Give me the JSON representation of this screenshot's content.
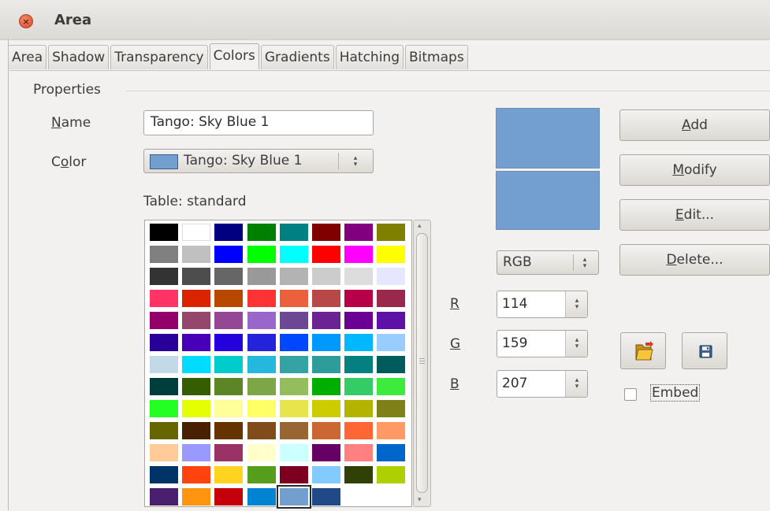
{
  "window": {
    "title": "Area",
    "close_glyph": "×"
  },
  "tabs": [
    {
      "label": "Area",
      "active": false
    },
    {
      "label": "Shadow",
      "active": false
    },
    {
      "label": "Transparency",
      "active": false
    },
    {
      "label": "Colors",
      "active": true
    },
    {
      "label": "Gradients",
      "active": false
    },
    {
      "label": "Hatching",
      "active": false
    },
    {
      "label": "Bitmaps",
      "active": false
    }
  ],
  "properties": {
    "section_label": "Properties",
    "name_label": "Name",
    "name_value": "Tango: Sky Blue 1",
    "color_label": "Color",
    "color_value": "Tango: Sky Blue 1",
    "color_swatch": "#729fcf",
    "table_label": "Table: standard"
  },
  "palette": [
    [
      "#000000",
      "#ffffff",
      "#000080",
      "#008000",
      "#008080",
      "#800000",
      "#800080",
      "#808000"
    ],
    [
      "#808080",
      "#c0c0c0",
      "#0000ff",
      "#00ff00",
      "#00ffff",
      "#ff0000",
      "#ff00ff",
      "#ffff00"
    ],
    [
      "#333333",
      "#4d4d4d",
      "#666666",
      "#999999",
      "#b3b3b3",
      "#cccccc",
      "#dddddd",
      "#e6e6ff"
    ],
    [
      "#ff3366",
      "#dc2300",
      "#b84700",
      "#ff3333",
      "#eb613d",
      "#b84747",
      "#b80047",
      "#99284c"
    ],
    [
      "#94006b",
      "#94476b",
      "#944794",
      "#9966cc",
      "#6b4794",
      "#6b2394",
      "#6b0094",
      "#5e11a6"
    ],
    [
      "#280099",
      "#4700b8",
      "#2300dc",
      "#2323dc",
      "#0047ff",
      "#0099ff",
      "#00b8ff",
      "#99ccff"
    ],
    [
      "#c2dae8",
      "#00dcff",
      "#00cccc",
      "#23b8dc",
      "#33a3a3",
      "#2f9c9c",
      "#038080",
      "#005c5c"
    ],
    [
      "#003e3e",
      "#355e00",
      "#5c8526",
      "#7da647",
      "#94bd5e",
      "#00ae00",
      "#33cc66",
      "#3deb3d"
    ],
    [
      "#23ff23",
      "#e6ff00",
      "#ffff99",
      "#ffff66",
      "#e6e64c",
      "#cccc00",
      "#b3b300",
      "#808019"
    ],
    [
      "#666600",
      "#472000",
      "#663300",
      "#804c19",
      "#996633",
      "#cc6633",
      "#ff6633",
      "#ff9966"
    ],
    [
      "#ffcc99",
      "#9999ff",
      "#993366",
      "#ffffcc",
      "#ccffff",
      "#660066",
      "#ff8080",
      "#0066cc"
    ],
    [
      "#003366",
      "#ff420e",
      "#ffd320",
      "#579d1c",
      "#7e0021",
      "#83caff",
      "#314004",
      "#aecf00"
    ],
    [
      "#4b1f6f",
      "#ff950e",
      "#c5000b",
      "#0084d1",
      "#729fcf",
      "#204a87"
    ]
  ],
  "selected_cell": {
    "row": 12,
    "col": 4
  },
  "preview_color": "#729fcf",
  "color_model": {
    "value": "RGB"
  },
  "channels": [
    {
      "label": "R",
      "value": "114"
    },
    {
      "label": "G",
      "value": "159"
    },
    {
      "label": "B",
      "value": "207"
    }
  ],
  "buttons": {
    "add": "Add",
    "modify": "Modify",
    "edit": "Edit...",
    "delete": "Delete..."
  },
  "embed": {
    "label": "Embed",
    "checked": false
  },
  "icons": {
    "load": "folder-open-icon",
    "save": "floppy-disk-icon"
  }
}
